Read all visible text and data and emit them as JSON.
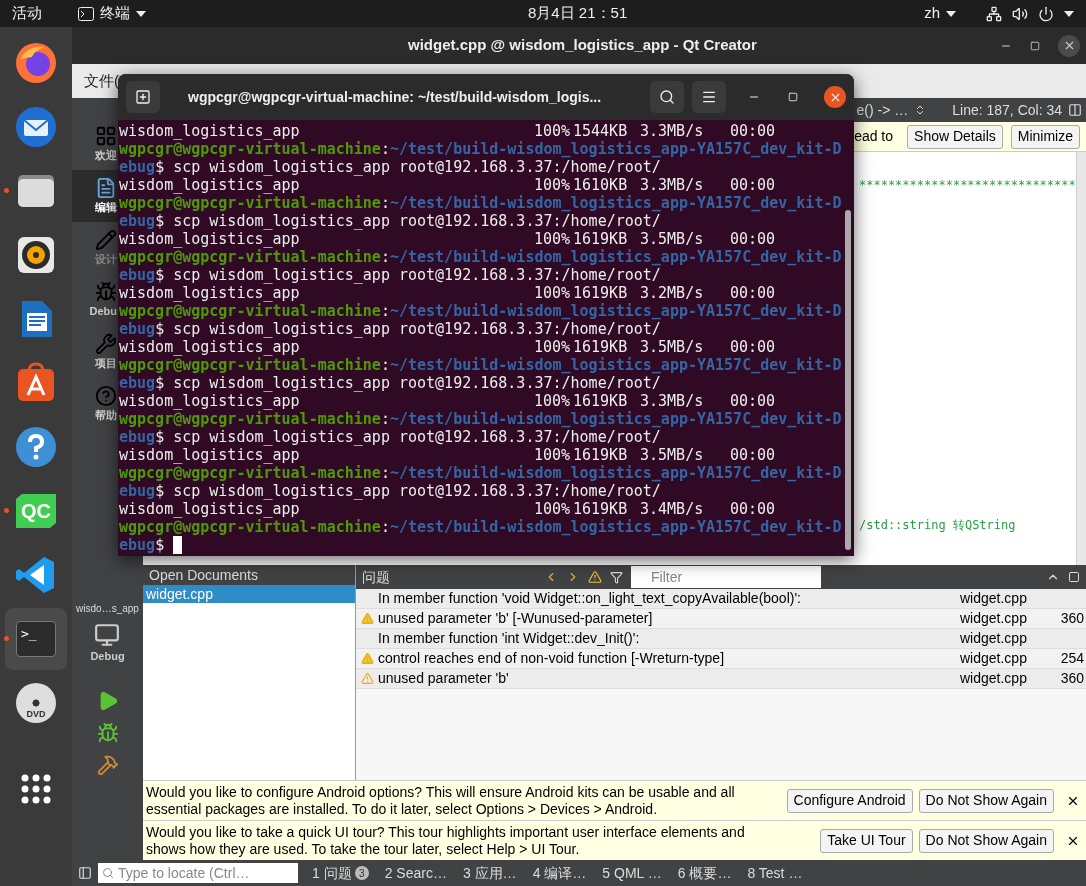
{
  "top_bar": {
    "activities": "活动",
    "app_menu": "终端",
    "clock": "8月4日  21：51",
    "input_method": "zh"
  },
  "dock": [
    {
      "kind": "firefox",
      "running": false,
      "selected": false
    },
    {
      "kind": "mail",
      "running": false,
      "selected": false
    },
    {
      "kind": "files",
      "running": true,
      "selected": false
    },
    {
      "kind": "music",
      "running": false,
      "selected": false
    },
    {
      "kind": "writer",
      "running": false,
      "selected": false
    },
    {
      "kind": "software",
      "running": false,
      "selected": false
    },
    {
      "kind": "help",
      "running": false,
      "selected": false
    },
    {
      "kind": "qt",
      "label": "QC",
      "running": true,
      "selected": false
    },
    {
      "kind": "code",
      "running": false,
      "selected": false
    },
    {
      "kind": "terminal",
      "label": ">_",
      "running": true,
      "selected": true
    },
    {
      "kind": "dvd",
      "label": "DVD",
      "running": false,
      "selected": false
    },
    {
      "kind": "apps",
      "running": false,
      "selected": false
    }
  ],
  "qt_window": {
    "title": "widget.cpp @ wisdom_logistics_app - Qt Creator",
    "menu": "文件(",
    "modes": [
      {
        "kind": "grid",
        "label": "欢迎",
        "selected": false,
        "disabled": false
      },
      {
        "kind": "edit",
        "label": "编辑",
        "selected": true,
        "disabled": false
      },
      {
        "kind": "design",
        "label": "设计",
        "selected": false,
        "disabled": true
      },
      {
        "kind": "debug",
        "label": "Debu",
        "selected": false,
        "disabled": false
      },
      {
        "kind": "projects",
        "label": "项目",
        "selected": false,
        "disabled": false
      },
      {
        "kind": "help",
        "label": "帮助",
        "selected": false,
        "disabled": false
      }
    ],
    "target": {
      "project": "wisdo…s_app",
      "build": "Debug"
    },
    "editor": {
      "function_combo": "e() -> …",
      "position": "Line: 187, Col: 34",
      "info_text": "ead to",
      "info_buttons": [
        "Show Details",
        "Minimize"
      ],
      "lines": [
        {
          "kind": "comment",
          "text": "******************************"
        },
        {
          "kind": "comment",
          "text": "/std::string 转QString"
        }
      ]
    },
    "open_documents": {
      "title": "Open Documents",
      "items": [
        {
          "name": "widget.cpp",
          "selected": true
        }
      ]
    },
    "issues": {
      "title": "问题",
      "filter_placeholder": "Filter",
      "rows": [
        {
          "kind": "context",
          "text": "In member function 'void Widget::on_light_text_copyAvailable(bool)':",
          "file": "widget.cpp"
        },
        {
          "kind": "warning",
          "text": "unused parameter 'b' [-Wunused-parameter]",
          "file": "widget.cpp",
          "line": "360"
        },
        {
          "kind": "context",
          "text": "In member function 'int Widget::dev_Init()':",
          "file": "widget.cpp"
        },
        {
          "kind": "warning",
          "text": "control reaches end of non-void function [-Wreturn-type]",
          "file": "widget.cpp",
          "line": "254"
        },
        {
          "kind": "note",
          "text": "unused parameter 'b'",
          "file": "widget.cpp",
          "line": "360"
        }
      ]
    },
    "info_bars": [
      {
        "text": "Would you like to configure Android options? This will ensure Android kits can be usable and all essential packages are installed. To do it later, select Options > Devices > Android.",
        "buttons": [
          "Configure Android",
          "Do Not Show Again"
        ]
      },
      {
        "text": "Would you like to take a quick UI tour? This tour highlights important user interface elements and shows how they are used. To take the tour later, select Help > UI Tour.",
        "buttons": [
          "Take UI Tour",
          "Do Not Show Again"
        ]
      }
    ],
    "status_bar": {
      "locate_placeholder": "Type to locate (Ctrl…",
      "tabs": [
        {
          "label": "1 问题",
          "badge": "3"
        },
        {
          "label": "2 Searc…"
        },
        {
          "label": "3 应用…"
        },
        {
          "label": "4 编译…"
        },
        {
          "label": "5 QML …"
        },
        {
          "label": "6 概要…"
        },
        {
          "label": "8 Test …"
        }
      ]
    }
  },
  "terminal": {
    "title": "wgpcgr@wgpcgr-virtual-machine: ~/test/build-wisdom_logis...",
    "separator": ":",
    "prompt_char": "$",
    "lines": [
      {
        "kind": "transfer",
        "file": "wisdom_logistics_app",
        "percent": "100%",
        "size": "1544KB",
        "rate": "3.3MB/s",
        "time": "00:00"
      },
      {
        "kind": "prompt",
        "user": "wgpcgr@wgpcgr-virtual-machine",
        "path_start": "~/test/build-wisdom_logistics_app-YA157C_dev_kit-D",
        "path_end": "ebug",
        "command": " scp wisdom_logistics_app root@192.168.3.37:/home/root/"
      },
      {
        "kind": "transfer",
        "file": "wisdom_logistics_app",
        "percent": "100%",
        "size": "1610KB",
        "rate": "3.3MB/s",
        "time": "00:00"
      },
      {
        "kind": "prompt",
        "user": "wgpcgr@wgpcgr-virtual-machine",
        "path_start": "~/test/build-wisdom_logistics_app-YA157C_dev_kit-D",
        "path_end": "ebug",
        "command": " scp wisdom_logistics_app root@192.168.3.37:/home/root/"
      },
      {
        "kind": "transfer",
        "file": "wisdom_logistics_app",
        "percent": "100%",
        "size": "1619KB",
        "rate": "3.5MB/s",
        "time": "00:00"
      },
      {
        "kind": "prompt",
        "user": "wgpcgr@wgpcgr-virtual-machine",
        "path_start": "~/test/build-wisdom_logistics_app-YA157C_dev_kit-D",
        "path_end": "ebug",
        "command": " scp wisdom_logistics_app root@192.168.3.37:/home/root/"
      },
      {
        "kind": "transfer",
        "file": "wisdom_logistics_app",
        "percent": "100%",
        "size": "1619KB",
        "rate": "3.2MB/s",
        "time": "00:00"
      },
      {
        "kind": "prompt",
        "user": "wgpcgr@wgpcgr-virtual-machine",
        "path_start": "~/test/build-wisdom_logistics_app-YA157C_dev_kit-D",
        "path_end": "ebug",
        "command": " scp wisdom_logistics_app root@192.168.3.37:/home/root/"
      },
      {
        "kind": "transfer",
        "file": "wisdom_logistics_app",
        "percent": "100%",
        "size": "1619KB",
        "rate": "3.5MB/s",
        "time": "00:00"
      },
      {
        "kind": "prompt",
        "user": "wgpcgr@wgpcgr-virtual-machine",
        "path_start": "~/test/build-wisdom_logistics_app-YA157C_dev_kit-D",
        "path_end": "ebug",
        "command": " scp wisdom_logistics_app root@192.168.3.37:/home/root/"
      },
      {
        "kind": "transfer",
        "file": "wisdom_logistics_app",
        "percent": "100%",
        "size": "1619KB",
        "rate": "3.3MB/s",
        "time": "00:00"
      },
      {
        "kind": "prompt",
        "user": "wgpcgr@wgpcgr-virtual-machine",
        "path_start": "~/test/build-wisdom_logistics_app-YA157C_dev_kit-D",
        "path_end": "ebug",
        "command": " scp wisdom_logistics_app root@192.168.3.37:/home/root/"
      },
      {
        "kind": "transfer",
        "file": "wisdom_logistics_app",
        "percent": "100%",
        "size": "1619KB",
        "rate": "3.5MB/s",
        "time": "00:00"
      },
      {
        "kind": "prompt",
        "user": "wgpcgr@wgpcgr-virtual-machine",
        "path_start": "~/test/build-wisdom_logistics_app-YA157C_dev_kit-D",
        "path_end": "ebug",
        "command": " scp wisdom_logistics_app root@192.168.3.37:/home/root/"
      },
      {
        "kind": "transfer",
        "file": "wisdom_logistics_app",
        "percent": "100%",
        "size": "1619KB",
        "rate": "3.4MB/s",
        "time": "00:00"
      },
      {
        "kind": "prompt",
        "user": "wgpcgr@wgpcgr-virtual-machine",
        "path_start": "~/test/build-wisdom_logistics_app-YA157C_dev_kit-D",
        "path_end": "ebug",
        "cursor": true
      }
    ]
  }
}
